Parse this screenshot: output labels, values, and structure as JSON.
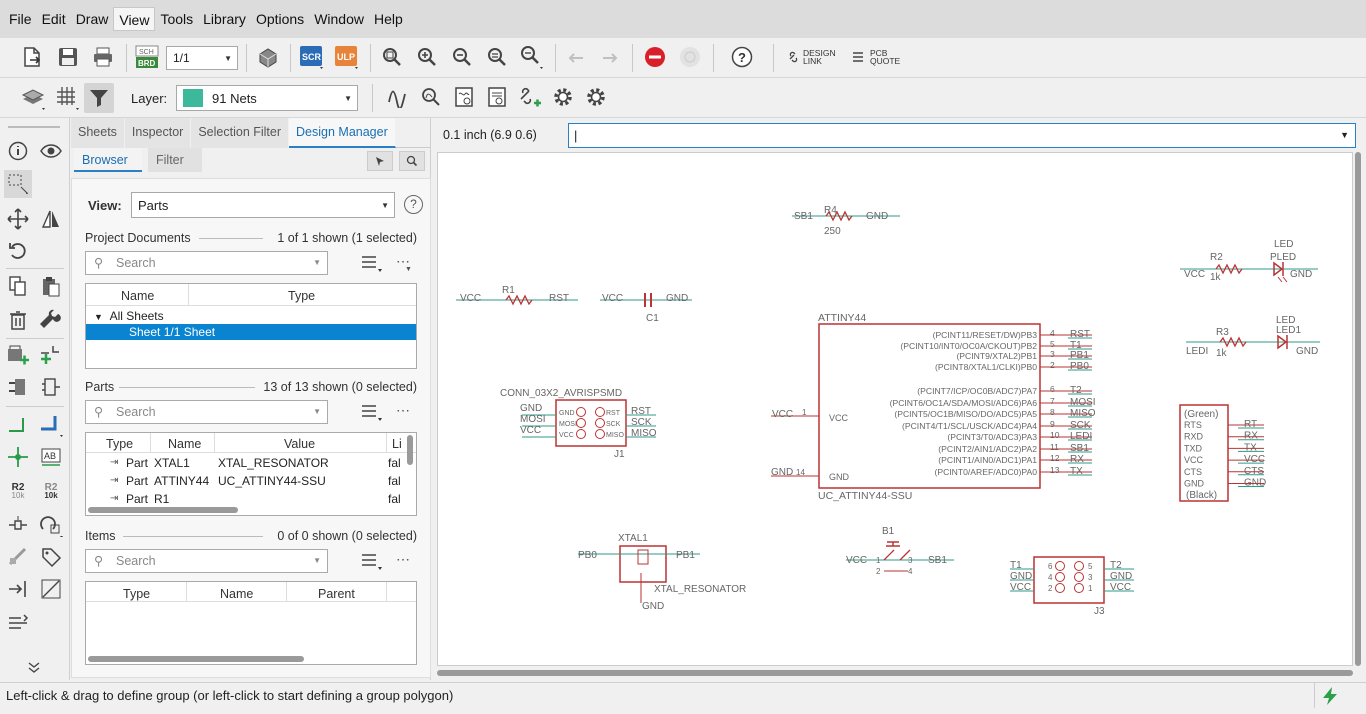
{
  "menu": [
    "File",
    "Edit",
    "Draw",
    "View",
    "Tools",
    "Library",
    "Options",
    "Window",
    "Help"
  ],
  "toolbar": {
    "zoom_ratio": "1/1",
    "design_link_l1": "DESIGN",
    "design_link_l2": "LINK",
    "pcb_quote_l1": "PCB",
    "pcb_quote_l2": "QUOTE",
    "scr_label": "SCR",
    "ulp_label": "ULP",
    "sch_label": "SCH",
    "brd_label": "BRD"
  },
  "layerbar": {
    "layer_label": "Layer:",
    "layer_value": "91 Nets",
    "layer_color": "#3cb89a"
  },
  "lefttools": {
    "r2_label": "R2",
    "r2_value": "10k"
  },
  "panel": {
    "tabs": [
      "Sheets",
      "Inspector",
      "Selection Filter",
      "Design Manager"
    ],
    "subtabs": [
      "Browser",
      "Filter"
    ],
    "view_label": "View:",
    "view_value": "Parts",
    "project_docs": {
      "label": "Project Documents",
      "count": "1 of 1 shown (1 selected)",
      "search_placeholder": "Search",
      "col_name": "Name",
      "col_type": "Type",
      "group": "All Sheets",
      "row_name": "Sheet 1/1",
      "row_type": "Sheet"
    },
    "parts": {
      "label": "Parts",
      "count": "13 of 13 shown (0 selected)",
      "search_placeholder": "Search",
      "col_type": "Type",
      "col_name": "Name",
      "col_value": "Value",
      "col_li": "Li",
      "rows": [
        {
          "type": "Part",
          "name": "XTAL1",
          "value": "XTAL_RESONATOR",
          "li": "fal"
        },
        {
          "type": "Part",
          "name": "ATTINY44",
          "value": "UC_ATTINY44-SSU",
          "li": "fal"
        },
        {
          "type": "Part",
          "name": "R1",
          "value": "",
          "li": "fal"
        }
      ]
    },
    "items": {
      "label": "Items",
      "count": "0 of 0 shown (0 selected)",
      "search_placeholder": "Search",
      "col_type": "Type",
      "col_name": "Name",
      "col_parent": "Parent"
    }
  },
  "canvas": {
    "coord": "0.1 inch (6.9 0.6)",
    "command_value": "|"
  },
  "schematic": {
    "r4": {
      "name": "R4",
      "value": "250",
      "left": "SB1",
      "right": "GND"
    },
    "r1": {
      "name": "R1",
      "left": "VCC",
      "right": "RST"
    },
    "c1": {
      "name": "C1",
      "left": "VCC",
      "right": "GND"
    },
    "led_top": {
      "res": "R2",
      "res_val": "1k",
      "label": "LED",
      "part": "PLED",
      "left": "VCC",
      "right": "GND"
    },
    "led_bot": {
      "res": "R3",
      "res_val": "1k",
      "label": "LED",
      "part": "LED1",
      "left": "LEDI",
      "right": "GND"
    },
    "mcu": {
      "name": "ATTINY44",
      "value": "UC_ATTINY44-SSU",
      "vcc_net": "VCC",
      "vcc_pin": "1",
      "vcc_label": "VCC",
      "gnd_net": "GND",
      "gnd_pin": "14",
      "gnd_label": "GND",
      "pins": [
        {
          "label": "(PCINT11/RESET/DW)PB3",
          "num": "4",
          "net": "RST"
        },
        {
          "label": "(PCINT10/INT0/OC0A/CKOUT)PB2",
          "num": "5",
          "net": "T1"
        },
        {
          "label": "(PCINT9/XTAL2)PB1",
          "num": "3",
          "net": "PB1"
        },
        {
          "label": "(PCINT8/XTAL1/CLKI)PB0",
          "num": "2",
          "net": "PB0"
        },
        {
          "label": "(PCINT7/ICP/OC0B/ADC7)PA7",
          "num": "6",
          "net": "T2"
        },
        {
          "label": "(PCINT6/OC1A/SDA/MOSI/ADC6)PA6",
          "num": "7",
          "net": "MOSI"
        },
        {
          "label": "(PCINT5/OC1B/MISO/DO/ADC5)PA5",
          "num": "8",
          "net": "MISO"
        },
        {
          "label": "(PCINT4/T1/SCL/USCK/ADC4)PA4",
          "num": "9",
          "net": "SCK"
        },
        {
          "label": "(PCINT3/T0/ADC3)PA3",
          "num": "10",
          "net": "LEDI"
        },
        {
          "label": "(PCINT2/AIN1/ADC2)PA2",
          "num": "11",
          "net": "SB1"
        },
        {
          "label": "(PCINT1/AIN0/ADC1)PA1",
          "num": "12",
          "net": "RX"
        },
        {
          "label": "(PCINT0/AREF/ADC0)PA0",
          "num": "13",
          "net": "TX"
        }
      ]
    },
    "isp": {
      "name": "CONN_03X2_AVRISPSMD",
      "ref": "J1",
      "left": [
        "GND",
        "MOSI",
        "VCC"
      ],
      "pinl": [
        "GND",
        "MOSI",
        "VCC"
      ],
      "pinr": [
        "RST",
        "SCK",
        "MISO"
      ],
      "right": [
        "RST",
        "SCK",
        "MISO"
      ]
    },
    "ftdi": {
      "top": "(Green)",
      "bottom": "(Black)",
      "pins": [
        "RTS",
        "RXD",
        "TXD",
        "VCC",
        "CTS",
        "GND"
      ],
      "nets": [
        "RT",
        "RX",
        "TX",
        "VCC",
        "CTS",
        "GND"
      ]
    },
    "xtal": {
      "name": "XTAL1",
      "value": "XTAL_RESONATOR",
      "left": "PB0",
      "right": "PB1",
      "bottom": "GND"
    },
    "button": {
      "name": "B1",
      "left": "VCC",
      "right": "SB1",
      "p1": "1",
      "p2": "2",
      "p3": "3",
      "p4": "4"
    },
    "j3": {
      "ref": "J3",
      "left": [
        "T1",
        "GND",
        "VCC"
      ],
      "lnum": [
        "6",
        "4",
        "2"
      ],
      "right": [
        "T2",
        "GND",
        "VCC"
      ],
      "rnum": [
        "5",
        "3",
        "1"
      ]
    }
  },
  "status": {
    "text": "Left-click & drag to define group (or left-click to start defining a group polygon)"
  }
}
